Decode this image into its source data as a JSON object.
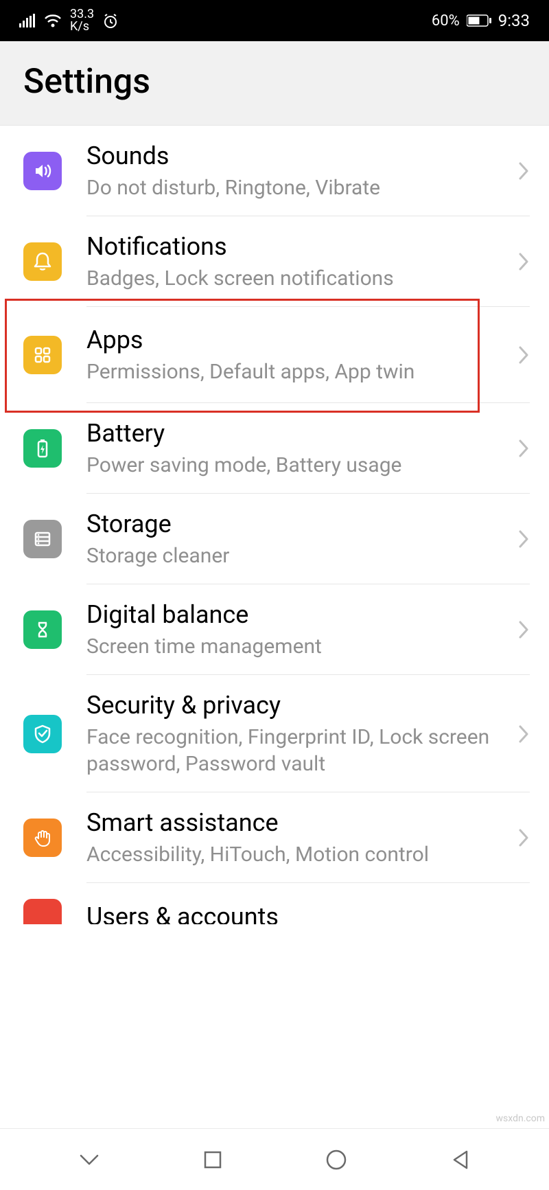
{
  "status_bar": {
    "speed_value": "33.3",
    "speed_unit": "K/s",
    "battery_percent": "60%",
    "time": "9:33"
  },
  "header": {
    "title": "Settings"
  },
  "items": [
    {
      "id": "sounds",
      "title": "Sounds",
      "subtitle": "Do not disturb, Ringtone, Vibrate",
      "icon_color": "#8c5ef2"
    },
    {
      "id": "notifications",
      "title": "Notifications",
      "subtitle": "Badges, Lock screen notifications",
      "icon_color": "#f3b926"
    },
    {
      "id": "apps",
      "title": "Apps",
      "subtitle": "Permissions, Default apps, App twin",
      "icon_color": "#f3b926"
    },
    {
      "id": "battery",
      "title": "Battery",
      "subtitle": "Power saving mode, Battery usage",
      "icon_color": "#1fbe6e"
    },
    {
      "id": "storage",
      "title": "Storage",
      "subtitle": "Storage cleaner",
      "icon_color": "#9a9a9a"
    },
    {
      "id": "digital-balance",
      "title": "Digital balance",
      "subtitle": "Screen time management",
      "icon_color": "#1fbe6e"
    },
    {
      "id": "security",
      "title": "Security & privacy",
      "subtitle": "Face recognition, Fingerprint ID, Lock screen password, Password vault",
      "icon_color": "#17c5c7"
    },
    {
      "id": "smart-assistance",
      "title": "Smart assistance",
      "subtitle": "Accessibility, HiTouch, Motion control",
      "icon_color": "#f58926"
    },
    {
      "id": "users-accounts",
      "title": "Users & accounts",
      "subtitle": "",
      "icon_color": "#ea4335"
    }
  ],
  "highlighted_item_id": "apps",
  "watermark": "wsxdn.com"
}
